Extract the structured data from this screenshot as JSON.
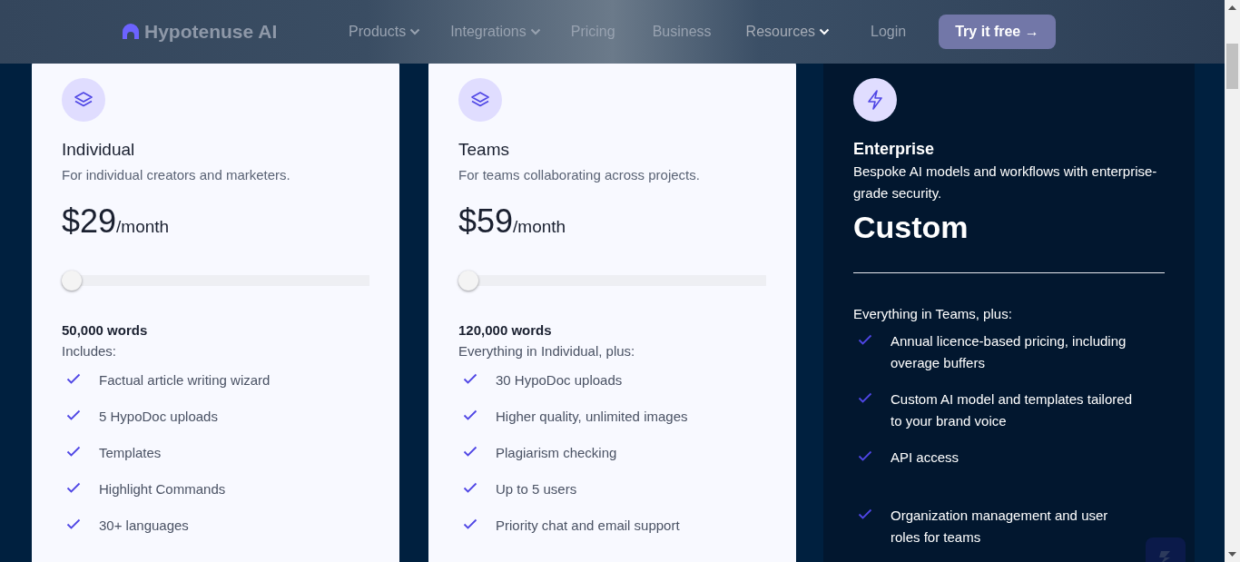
{
  "header": {
    "logo": "Hypotenuse AI",
    "nav": [
      {
        "label": "Products",
        "dropdown": true
      },
      {
        "label": "Integrations",
        "dropdown": true
      },
      {
        "label": "Pricing",
        "dropdown": false
      },
      {
        "label": "Business",
        "dropdown": false
      },
      {
        "label": "Resources",
        "dropdown": true
      },
      {
        "label": "Login",
        "dropdown": false
      }
    ],
    "cta": "Try it free →"
  },
  "plans": [
    {
      "kind": "standard",
      "name": "Individual",
      "description": "For individual creators and marketers.",
      "price": "$29",
      "period": "/month",
      "level": 0,
      "words": "50,000 words",
      "includes": "Includes:",
      "features": [
        "Factual article writing wizard",
        "5 HypoDoc uploads",
        "Templates",
        "Highlight Commands",
        "30+ languages"
      ]
    },
    {
      "kind": "standard",
      "name": "Teams",
      "description": "For teams collaborating across projects.",
      "price": "$59",
      "period": "/month",
      "level": 0,
      "words": "120,000 words",
      "includes": "Everything in Individual, plus:",
      "features": [
        "30 HypoDoc uploads",
        "Higher quality, unlimited images",
        "Plagiarism checking",
        "Up to 5 users",
        "Priority chat and email support"
      ]
    },
    {
      "kind": "enterprise",
      "name": "Enterprise",
      "description": "Bespoke AI models and workflows with enterprise-grade security.",
      "price": "Custom",
      "includes": "Everything in Teams, plus:",
      "features": [
        "Annual licence-based pricing, including overage buffers",
        "Custom AI model and templates tailored to your brand voice",
        "API access",
        "Organization management and user roles for teams"
      ]
    }
  ]
}
